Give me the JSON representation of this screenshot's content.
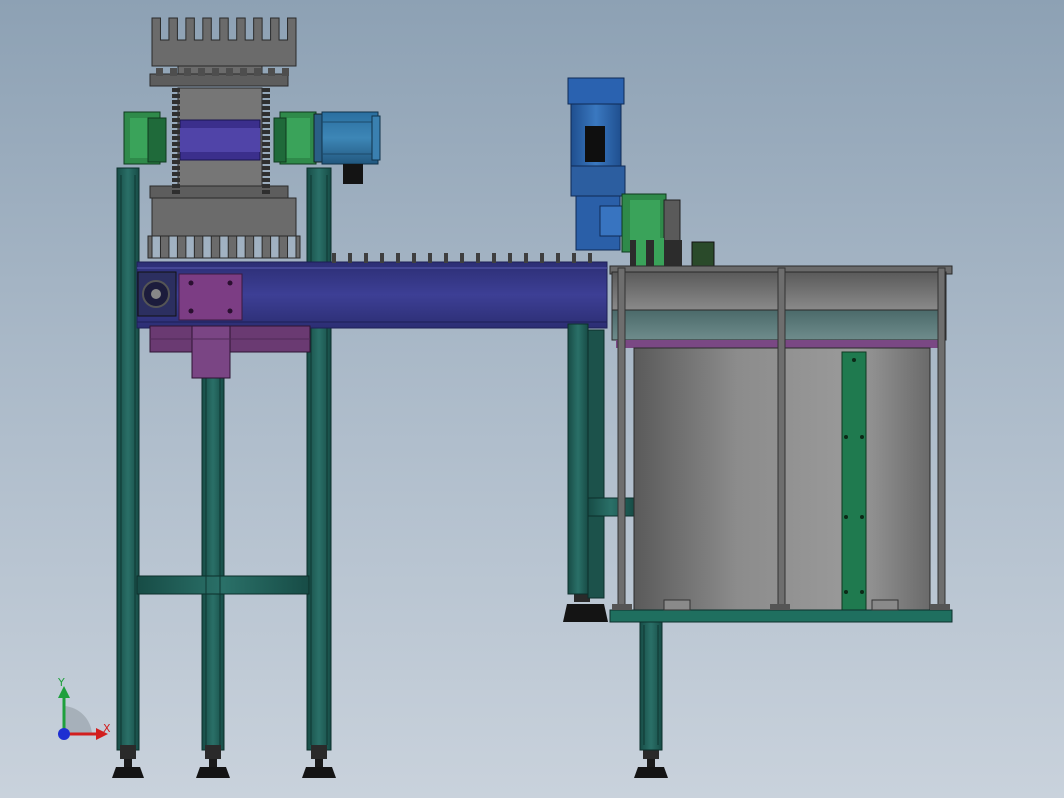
{
  "view": {
    "background_top": "#8da1b4",
    "background_bottom": "#c9d2dc"
  },
  "triad": {
    "x_label": "X",
    "y_label": "Y",
    "x_color": "#d21e1e",
    "y_color": "#1ea03c",
    "z_color": "#1e2fd2"
  },
  "colors": {
    "frame_green": "#1f5f58",
    "frame_dark": "#123d38",
    "conveyor_purple": "#3a3c8c",
    "bracket_purple": "#7a3a80",
    "motor_blue": "#2f6f9a",
    "gearbox_blue": "#2a5fa8",
    "bearing_green": "#2f8a4a",
    "sprocket_grey": "#5e5e5e",
    "drum_grey": "#7f7f7f",
    "foot_black": "#141414"
  }
}
